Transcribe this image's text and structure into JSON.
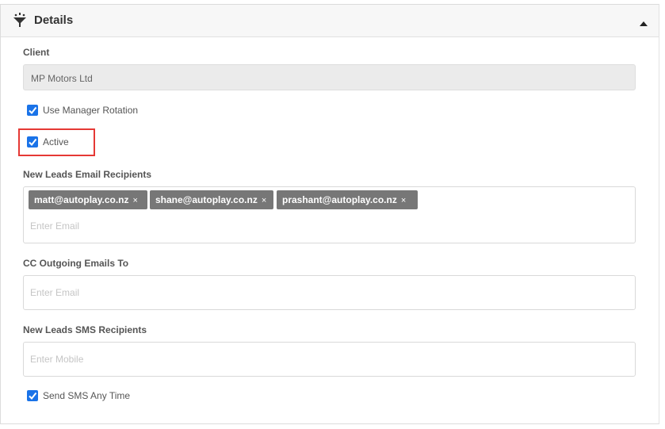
{
  "panel": {
    "title": "Details",
    "icon": "filter-funnel-icon",
    "collapse_icon": "caret-up-icon"
  },
  "client": {
    "label": "Client",
    "value": "MP Motors Ltd"
  },
  "use_manager_rotation": {
    "label": "Use Manager Rotation",
    "checked": true
  },
  "active": {
    "label": "Active",
    "checked": true
  },
  "new_leads_email": {
    "label": "New Leads Email Recipients",
    "tags": [
      "matt@autoplay.co.nz",
      "shane@autoplay.co.nz",
      "prashant@autoplay.co.nz"
    ],
    "remove_symbol": "×",
    "placeholder": "Enter Email"
  },
  "cc_outgoing": {
    "label": "CC Outgoing Emails To",
    "placeholder": "Enter Email"
  },
  "new_leads_sms": {
    "label": "New Leads SMS Recipients",
    "placeholder": "Enter Mobile"
  },
  "send_sms_any_time": {
    "label": "Send SMS Any Time",
    "checked": true
  },
  "colors": {
    "checkbox": "#1a73e8",
    "highlight": "#e53935",
    "tag": "#777777"
  }
}
